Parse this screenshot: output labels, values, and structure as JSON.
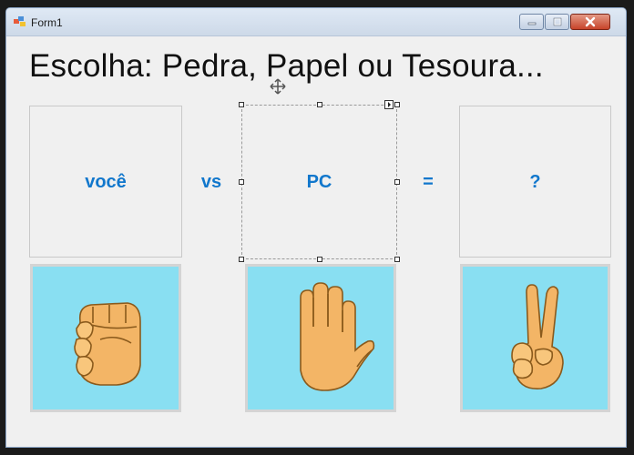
{
  "window": {
    "title": "Form1"
  },
  "heading": "Escolha: Pedra, Papel ou Tesoura...",
  "labels": {
    "player": "você",
    "versus": "vs",
    "pc": "PC",
    "equals": "=",
    "result": "?"
  },
  "images": {
    "player": "rock-fist-icon",
    "pc": "paper-hand-icon",
    "result": "scissors-victory-hand-icon"
  },
  "colors": {
    "label_blue": "#1177cc",
    "picture_background": "#89dff2",
    "skin": "#f3b566"
  }
}
